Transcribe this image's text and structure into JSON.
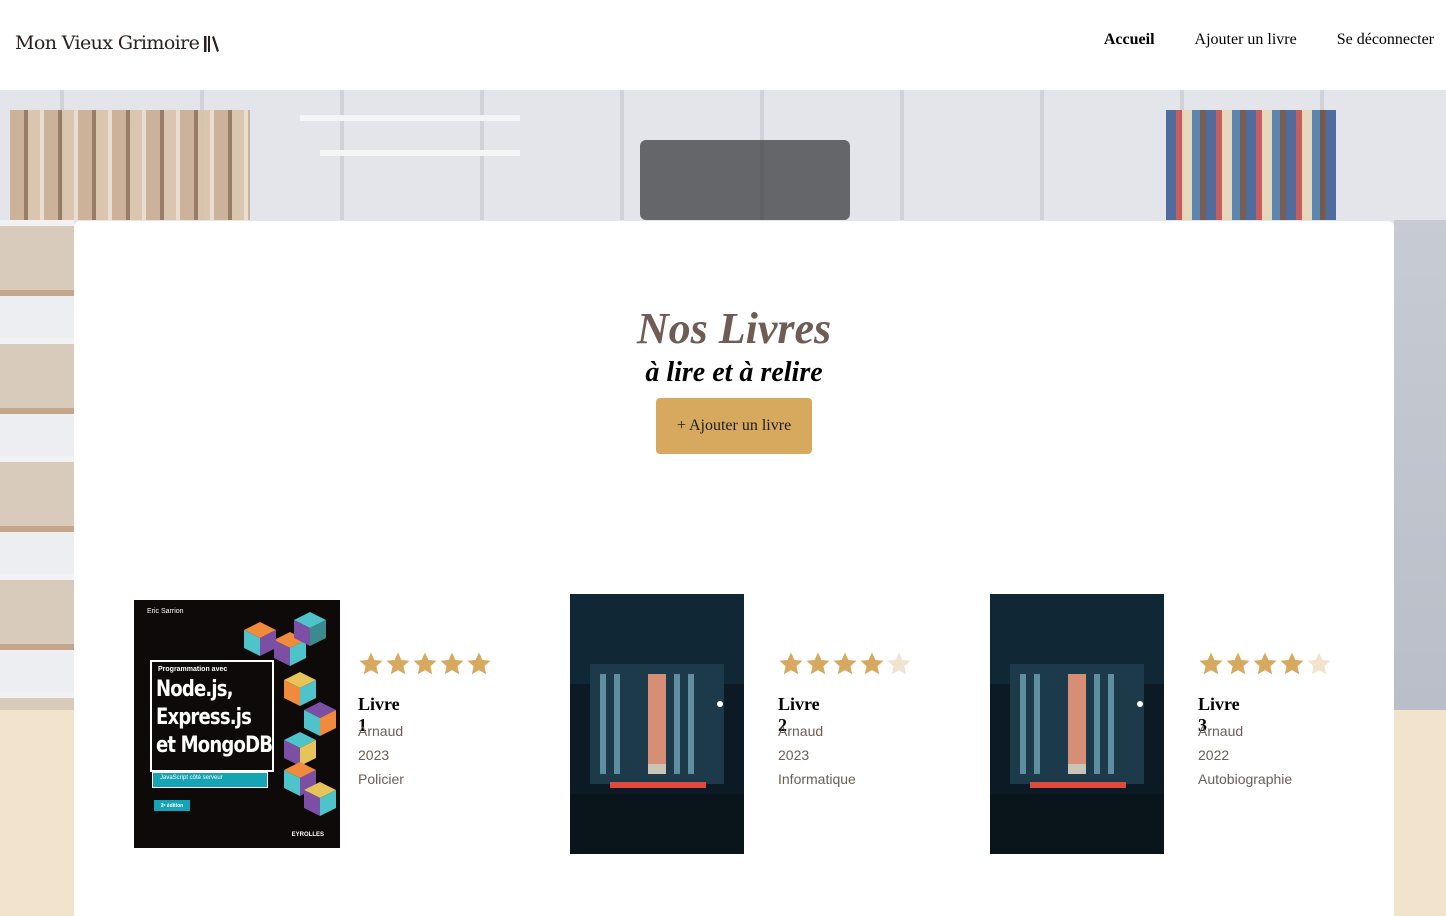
{
  "header": {
    "logo_text": "Mon Vieux Grimoire",
    "nav": [
      {
        "label": "Accueil",
        "active": true
      },
      {
        "label": "Ajouter un livre",
        "active": false
      },
      {
        "label": "Se déconnecter",
        "active": false
      }
    ]
  },
  "main": {
    "title": "Nos Livres",
    "subtitle": "à lire et à relire",
    "add_button_label": "+ Ajouter un livre"
  },
  "books": [
    {
      "title": "Livre 1",
      "author": "Arnaud",
      "year": "2023",
      "genre": "Policier",
      "rating": 5,
      "cover": {
        "author": "Eric Sarrion",
        "pre_title": "Programmation avec",
        "line1": "Node.js,",
        "line2": "Express.js",
        "line3": "et MongoDB",
        "band_text": "JavaScript côté serveur",
        "edition": "2ᵉ édition",
        "publisher": "EYROLLES"
      }
    },
    {
      "title": "Livre 2",
      "author": "Arnaud",
      "year": "2023",
      "genre": "Informatique",
      "rating": 4
    },
    {
      "title": "Livre 3",
      "author": "Arnaud",
      "year": "2022",
      "genre": "Autobiographie",
      "rating": 4
    }
  ],
  "colors": {
    "accent": "#d6a95f",
    "star_filled": "#d6a95f",
    "star_empty": "#f2e3cd",
    "band": "#f2e3cd",
    "title": "#6e5c55"
  }
}
